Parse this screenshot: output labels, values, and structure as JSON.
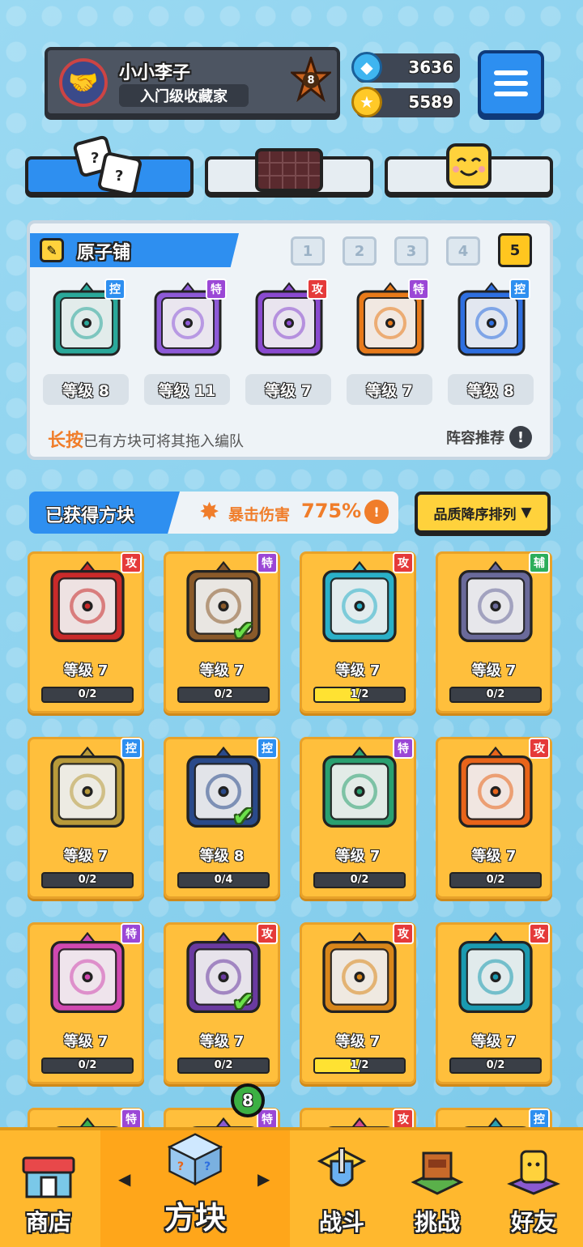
{
  "profile": {
    "name": "小小李子",
    "title": "入门级收藏家",
    "rank": "8"
  },
  "currency": {
    "gems": "3636",
    "coins": "5589"
  },
  "deck": {
    "title": "原子铺",
    "slots": [
      "1",
      "2",
      "3",
      "4",
      "5"
    ],
    "active_slot": 5,
    "blocks": [
      {
        "tag": "控",
        "tag_type": "ctl",
        "level": "等级 8",
        "color": "#2aa89a",
        "icon": "wave-icon"
      },
      {
        "tag": "特",
        "tag_type": "spc",
        "level": "等级 11",
        "color": "#8e5ad8",
        "icon": "crack-icon"
      },
      {
        "tag": "攻",
        "tag_type": "atk",
        "level": "等级 7",
        "color": "#8a4ad0",
        "icon": "orbit-icon"
      },
      {
        "tag": "特",
        "tag_type": "spc",
        "level": "等级 7",
        "color": "#e87a1a",
        "icon": "infinity-icon"
      },
      {
        "tag": "控",
        "tag_type": "ctl",
        "level": "等级 8",
        "color": "#2e6fe0",
        "icon": "snowflake-icon"
      }
    ],
    "hint_emph": "长按",
    "hint_rest": "已有方块可将其拖入编队",
    "recommend": "阵容推荐",
    "recommend_icon": "!"
  },
  "owned": {
    "title": "已获得方块",
    "crit_label": "暴击伤害",
    "crit_value": "775%",
    "crit_icon": "!",
    "sort_label": "品质降序排列",
    "sort_arrow": "▼"
  },
  "cards": [
    {
      "tag": "攻",
      "tag_type": "atk",
      "level": "等级 7",
      "progress": "0/2",
      "fill": 0,
      "in_deck": false,
      "color": "#c92a2a",
      "icon": "compass-icon"
    },
    {
      "tag": "特",
      "tag_type": "spc",
      "level": "等级 7",
      "progress": "0/2",
      "fill": 0,
      "in_deck": true,
      "color": "#8a5a2a",
      "icon": "infinity-icon"
    },
    {
      "tag": "攻",
      "tag_type": "atk",
      "level": "等级 7",
      "progress": "1/2",
      "fill": 0.5,
      "in_deck": false,
      "color": "#2ab0c8",
      "icon": "trident-icon"
    },
    {
      "tag": "辅",
      "tag_type": "sup",
      "level": "等级 7",
      "progress": "0/2",
      "fill": 0,
      "in_deck": false,
      "color": "#6a6a9a",
      "icon": "jaw-icon"
    },
    {
      "tag": "控",
      "tag_type": "ctl",
      "level": "等级 7",
      "progress": "0/2",
      "fill": 0,
      "in_deck": false,
      "color": "#b89a3a",
      "icon": "target-icon"
    },
    {
      "tag": "控",
      "tag_type": "ctl",
      "level": "等级 8",
      "progress": "0/4",
      "fill": 0,
      "in_deck": true,
      "color": "#2a4a8a",
      "icon": "snowflake-icon"
    },
    {
      "tag": "特",
      "tag_type": "spc",
      "level": "等级 7",
      "progress": "0/2",
      "fill": 0,
      "in_deck": false,
      "color": "#2aa070",
      "icon": "star-icon"
    },
    {
      "tag": "攻",
      "tag_type": "atk",
      "level": "等级 7",
      "progress": "0/2",
      "fill": 0,
      "in_deck": false,
      "color": "#e8641a",
      "icon": "saw-icon"
    },
    {
      "tag": "特",
      "tag_type": "spc",
      "level": "等级 7",
      "progress": "0/2",
      "fill": 0,
      "in_deck": false,
      "color": "#d048b0",
      "icon": "syringe-icon"
    },
    {
      "tag": "攻",
      "tag_type": "atk",
      "level": "等级 7",
      "progress": "0/2",
      "fill": 0,
      "in_deck": true,
      "color": "#6a3aa0",
      "icon": "orbit-icon"
    },
    {
      "tag": "攻",
      "tag_type": "atk",
      "level": "等级 7",
      "progress": "1/2",
      "fill": 0.5,
      "in_deck": false,
      "color": "#d8861a",
      "icon": "pistol-icon"
    },
    {
      "tag": "攻",
      "tag_type": "atk",
      "level": "等级 7",
      "progress": "0/2",
      "fill": 0,
      "in_deck": false,
      "color": "#1a9ab0",
      "icon": "vortex-icon"
    },
    {
      "tag": "特",
      "tag_type": "spc",
      "level": "",
      "progress": "",
      "fill": 0,
      "in_deck": false,
      "color": "#3ab050",
      "icon": "block-icon"
    },
    {
      "tag": "特",
      "tag_type": "spc",
      "level": "",
      "progress": "",
      "fill": 0,
      "in_deck": false,
      "color": "#8a5ad0",
      "icon": "block-icon"
    },
    {
      "tag": "攻",
      "tag_type": "atk",
      "level": "",
      "progress": "",
      "fill": 0,
      "in_deck": false,
      "color": "#d04a8a",
      "icon": "block-icon"
    },
    {
      "tag": "控",
      "tag_type": "ctl",
      "level": "",
      "progress": "",
      "fill": 0,
      "in_deck": false,
      "color": "#2aa0b0",
      "icon": "block-icon"
    }
  ],
  "nav": {
    "shop": "商店",
    "blocks": "方块",
    "battle": "战斗",
    "challenge": "挑战",
    "friends": "好友",
    "blocks_badge": "8",
    "arrow_left": "◀",
    "arrow_right": "▶"
  }
}
